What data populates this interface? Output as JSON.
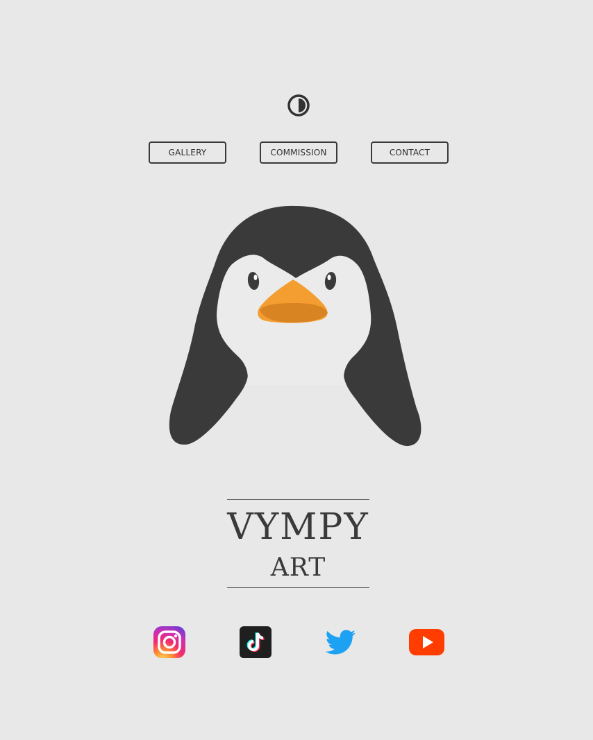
{
  "header": {
    "theme_toggle_icon": "contrast-icon"
  },
  "nav": {
    "items": [
      {
        "label": "GALLERY"
      },
      {
        "label": "COMMISSION"
      },
      {
        "label": "CONTACT"
      }
    ]
  },
  "hero": {
    "image": "penguin-illustration",
    "colors": {
      "body": "#3a3a3a",
      "face": "#ebebeb",
      "beak": "#f49d30"
    }
  },
  "logo": {
    "title": "VYMPY",
    "subtitle": "ART"
  },
  "social": [
    {
      "icon": "instagram-icon"
    },
    {
      "icon": "tiktok-icon"
    },
    {
      "icon": "twitter-icon"
    },
    {
      "icon": "youtube-icon"
    }
  ],
  "colors": {
    "background": "#e8e8e8",
    "text": "#3a3a3a"
  }
}
